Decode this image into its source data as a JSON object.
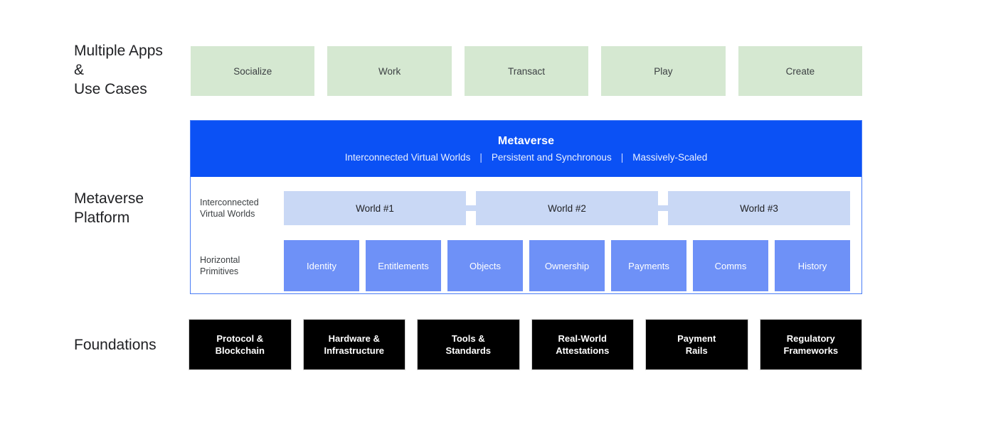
{
  "diagram": {
    "title": "Metaverse Stack Diagram",
    "colors": {
      "apps_fill": "#d5e8d1",
      "platform_header": "#0b51f5",
      "platform_border": "#4a7df5",
      "world_fill": "#c9d8f5",
      "primitive_fill": "#6e91f7",
      "foundation_fill": "#000000",
      "foundation_border": "#d0d0d0",
      "text_dark": "#202124",
      "text_light": "#ffffff"
    }
  },
  "rows": {
    "apps": {
      "label": "Multiple Apps\n&\nUse Cases",
      "items": [
        {
          "label": "Socialize"
        },
        {
          "label": "Work"
        },
        {
          "label": "Transact"
        },
        {
          "label": "Play"
        },
        {
          "label": "Create"
        }
      ]
    },
    "platform": {
      "label": "Metaverse\nPlatform",
      "header": {
        "title": "Metaverse",
        "subtitle_parts": [
          "Interconnected Virtual Worlds",
          "Persistent and Synchronous",
          "Massively-Scaled"
        ],
        "separator": "|"
      },
      "worlds_section": {
        "label": "Interconnected\nVirtual Worlds",
        "items": [
          {
            "label": "World #1"
          },
          {
            "label": "World #2"
          },
          {
            "label": "World #3"
          }
        ]
      },
      "primitives_section": {
        "label": "Horizontal\nPrimitives",
        "items": [
          {
            "label": "Identity"
          },
          {
            "label": "Entitlements"
          },
          {
            "label": "Objects"
          },
          {
            "label": "Ownership"
          },
          {
            "label": "Payments"
          },
          {
            "label": "Comms"
          },
          {
            "label": "History"
          }
        ]
      }
    },
    "foundations": {
      "label": "Foundations",
      "items": [
        {
          "label": "Protocol &\nBlockchain"
        },
        {
          "label": "Hardware &\nInfrastructure"
        },
        {
          "label": "Tools &\nStandards"
        },
        {
          "label": "Real-World\nAttestations"
        },
        {
          "label": "Payment\nRails"
        },
        {
          "label": "Regulatory\nFrameworks"
        }
      ]
    }
  }
}
